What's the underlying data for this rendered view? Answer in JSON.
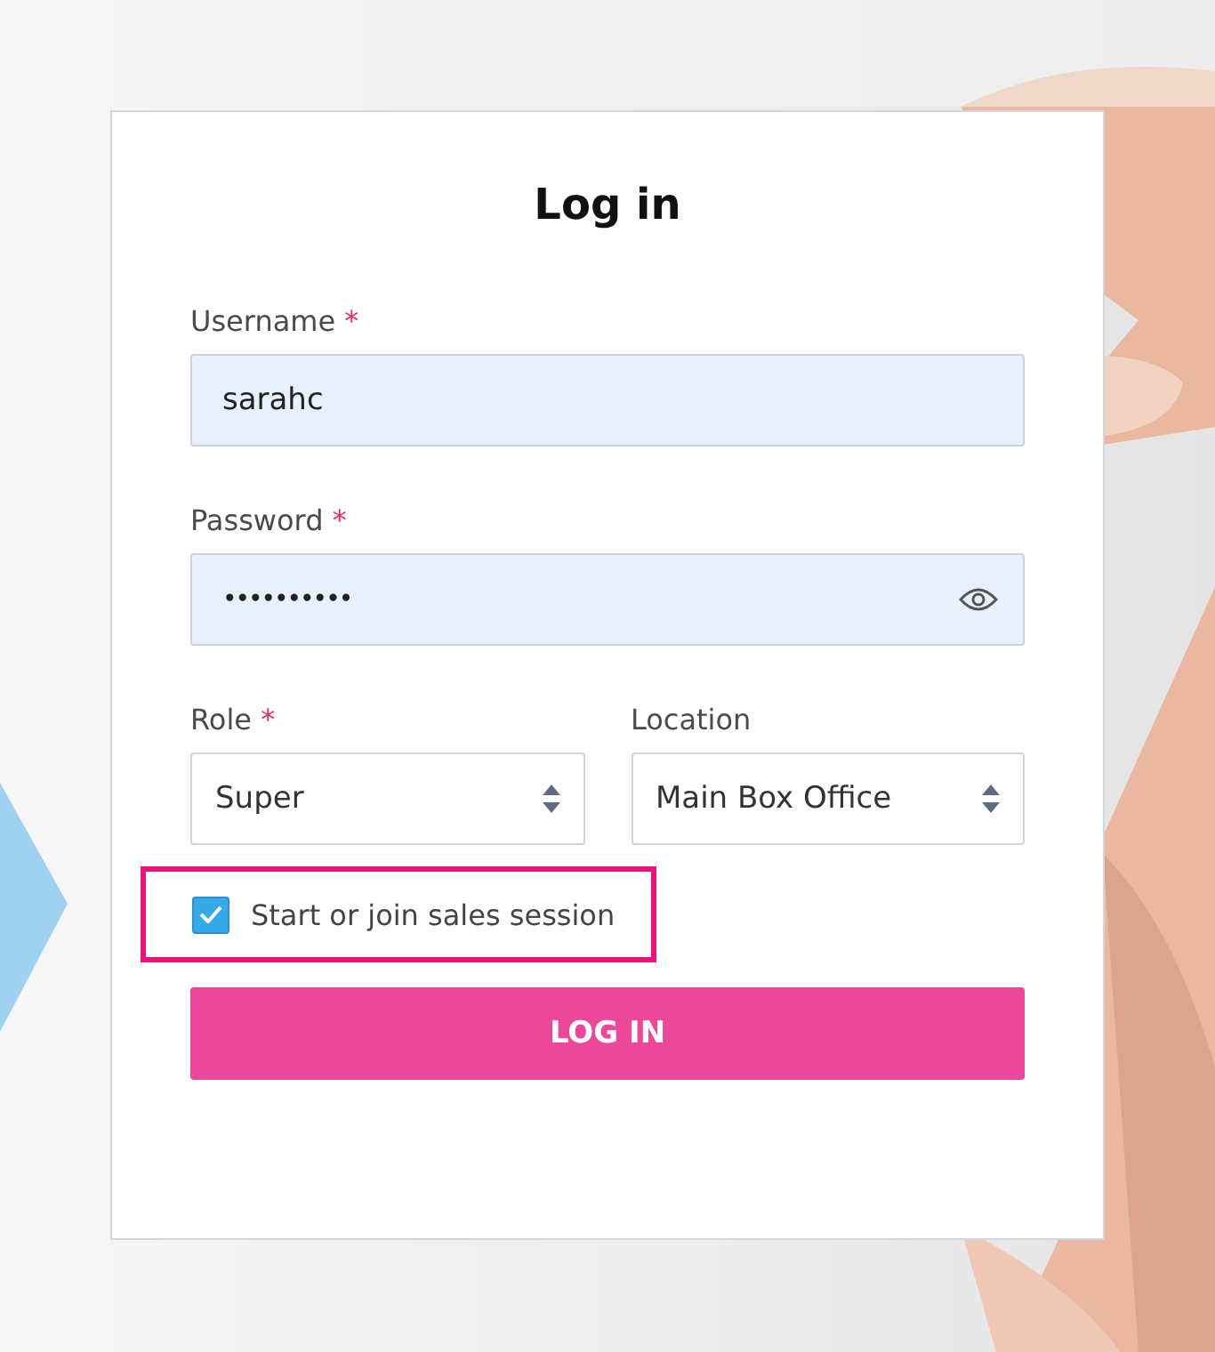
{
  "title": "Log in",
  "fields": [
    {
      "kind": "text",
      "label": "Username",
      "required_mark": "*",
      "value": "sarahc"
    },
    {
      "kind": "password",
      "label": "Password",
      "required_mark": "*",
      "value": "••••••••••"
    }
  ],
  "selects": [
    {
      "label": "Role",
      "required_mark": "*",
      "value": "Super"
    },
    {
      "label": "Location",
      "value": "Main Box Office"
    }
  ],
  "session_checkbox": {
    "label": "Start or join sales session",
    "checked": true,
    "highlighted": true
  },
  "submit_button": "LOG IN"
}
